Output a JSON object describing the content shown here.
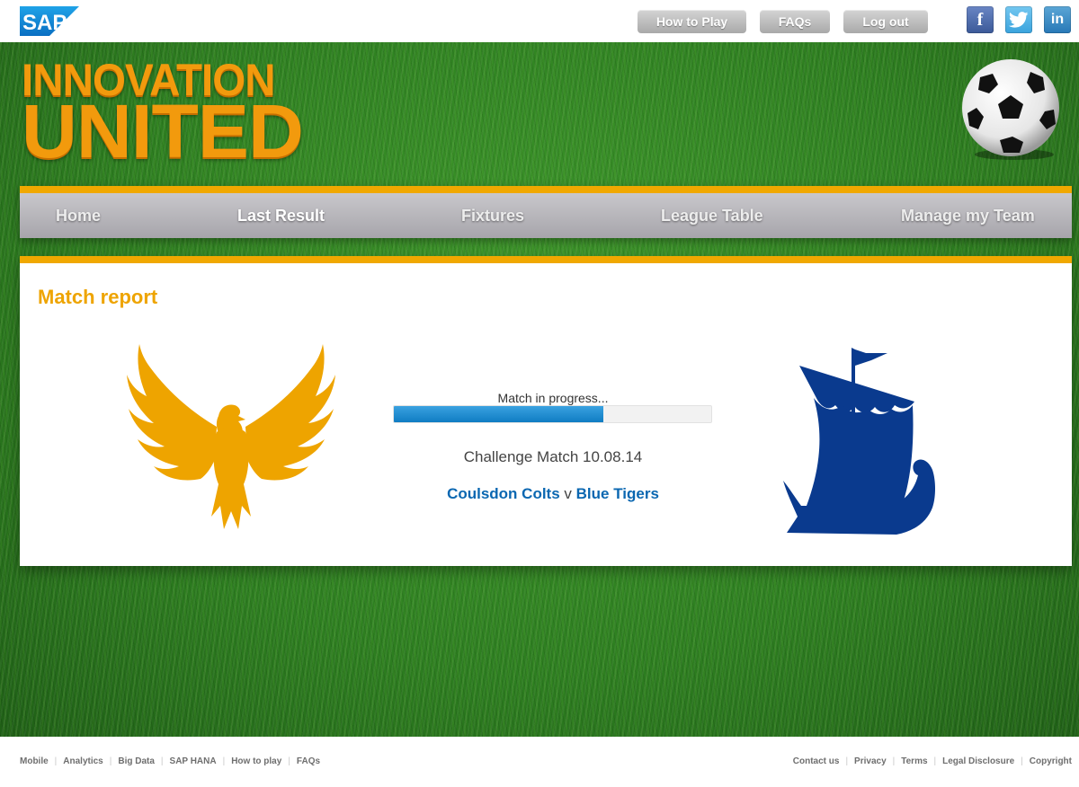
{
  "header": {
    "logo_text": "SAP",
    "buttons": [
      {
        "label": "How to Play"
      },
      {
        "label": "FAQs"
      },
      {
        "label": "Log out"
      }
    ],
    "social": [
      {
        "icon": "facebook-icon",
        "glyph": "f",
        "color": "#3b5998"
      },
      {
        "icon": "twitter-icon",
        "color": "#3aa3dd"
      },
      {
        "icon": "linkedin-icon",
        "glyph": "in",
        "color": "#2878b6"
      }
    ]
  },
  "brand": {
    "line1": "INNOVATION",
    "line2": "UNITED"
  },
  "nav": {
    "items": [
      {
        "label": "Home"
      },
      {
        "label": "Last Result",
        "active": true
      },
      {
        "label": "Fixtures"
      },
      {
        "label": "League Table"
      },
      {
        "label": "Manage my Team"
      }
    ]
  },
  "match": {
    "section_title": "Match report",
    "status": "Match in progress...",
    "progress": 0.66,
    "title": "Challenge Match 10.08.14",
    "home_team": "Coulsdon Colts",
    "versus": "v",
    "away_team": "Blue Tigers",
    "home_crest": "eagle-crest-icon",
    "away_crest": "viking-ship-crest-icon"
  },
  "footer": {
    "left_links": [
      "Mobile",
      "Analytics",
      "Big Data",
      "SAP HANA",
      "How to play",
      "FAQs"
    ],
    "right_links": [
      "Contact us",
      "Privacy",
      "Terms",
      "Legal Disclosure",
      "Copyright"
    ]
  },
  "colors": {
    "accent": "#f0a800",
    "team_link": "#0a67b1",
    "home_crest": "#eea400",
    "away_crest": "#0a3a8e",
    "progress": "#1a88cf"
  }
}
